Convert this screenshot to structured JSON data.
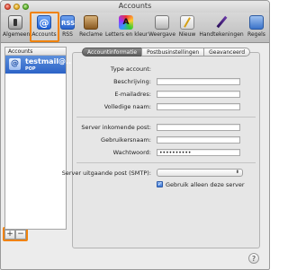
{
  "window": {
    "title": "Accounts"
  },
  "toolbar": {
    "items": [
      {
        "label": "Algemeen",
        "icon": "general-switch-icon"
      },
      {
        "label": "Accounts",
        "icon": "at-sign-icon",
        "glyph": "@"
      },
      {
        "label": "RSS",
        "icon": "rss-icon",
        "glyph": "RSS"
      },
      {
        "label": "Reclame",
        "icon": "junk-mail-icon"
      },
      {
        "label": "Letters en kleur",
        "icon": "fonts-colors-icon",
        "glyph": "A"
      },
      {
        "label": "Weergave",
        "icon": "viewing-icon"
      },
      {
        "label": "Nieuw",
        "icon": "composing-icon"
      },
      {
        "label": "Handtekeningen",
        "icon": "signatures-pen-icon"
      },
      {
        "label": "Regels",
        "icon": "rules-icon"
      }
    ],
    "highlight_color": "#f0820a"
  },
  "sidebar": {
    "header": "Accounts",
    "accounts": [
      {
        "name": "testmail@...",
        "type": "POP",
        "glyph": "@"
      }
    ],
    "add_label": "+",
    "remove_label": "−"
  },
  "tabs": [
    {
      "label": "Accountinformatie",
      "active": true
    },
    {
      "label": "Postbusinstellingen",
      "active": false
    },
    {
      "label": "Geavanceerd",
      "active": false
    }
  ],
  "form": {
    "type_label": "Type account:",
    "type_value": "",
    "description_label": "Beschrijving:",
    "description_value": "",
    "email_label": "E-mailadres:",
    "email_value": "",
    "fullname_label": "Volledige naam:",
    "fullname_value": "",
    "incoming_label": "Server inkomende post:",
    "incoming_value": "",
    "username_label": "Gebruikersnaam:",
    "username_value": "",
    "password_label": "Wachtwoord:",
    "password_value": "••••••••••",
    "smtp_label": "Server uitgaande post (SMTP):",
    "smtp_value": "",
    "smtp_arrows": "⬍",
    "only_this_server_label": "Gebruik alleen deze server",
    "only_this_server_checked": true,
    "check_glyph": "✓"
  },
  "help": {
    "label": "?"
  }
}
